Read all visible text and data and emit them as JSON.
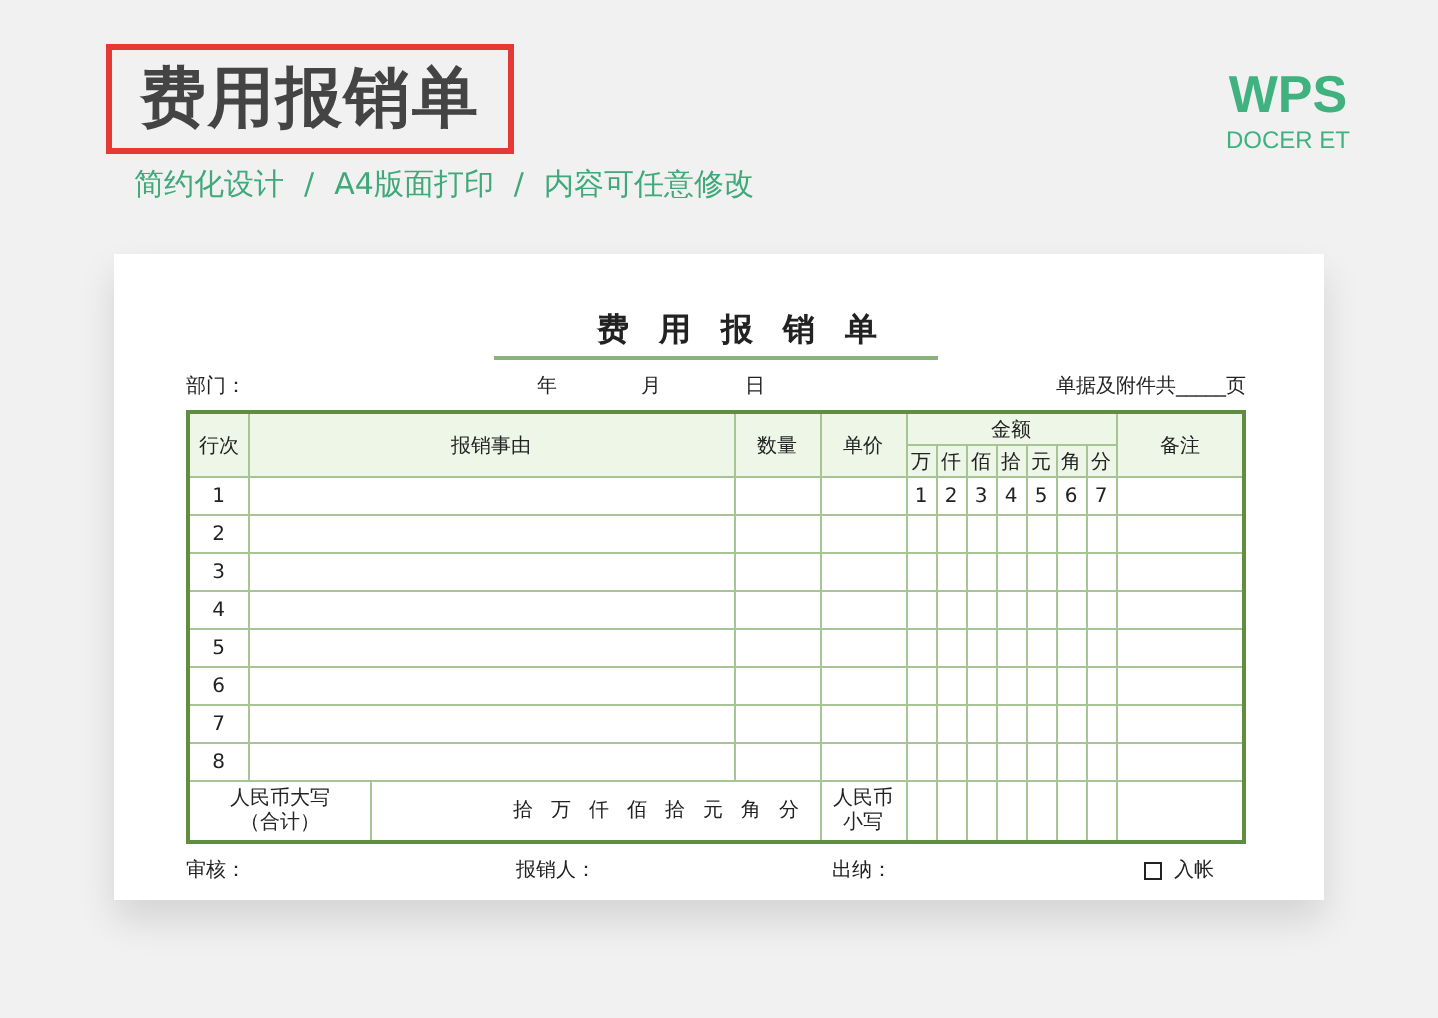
{
  "banner": {
    "title": "费用报销单",
    "highlighted": true,
    "taglines": [
      "简约化设计",
      "A4版面打印",
      "内容可任意修改"
    ],
    "separators": [
      "/",
      "/"
    ]
  },
  "logo": {
    "name": "WPS",
    "subtitle": "DOCER ET"
  },
  "form": {
    "title": "费用报销单",
    "meta": {
      "department": "部门：",
      "date": [
        "年",
        "月",
        "日"
      ],
      "attachments": "单据及附件共_____页"
    },
    "columns": {
      "line": "行次",
      "reason": "报销事由",
      "quantity": "数量",
      "price": "单价",
      "amount": "金额",
      "units": [
        "万",
        "仟",
        "佰",
        "拾",
        "元",
        "角",
        "分"
      ],
      "remark": "备注"
    },
    "rows": [
      {
        "line": "1",
        "digits": [
          "1",
          "2",
          "3",
          "4",
          "5",
          "6",
          "7"
        ]
      },
      {
        "line": "2",
        "digits": []
      },
      {
        "line": "3",
        "digits": []
      },
      {
        "line": "4",
        "digits": []
      },
      {
        "line": "5",
        "digits": []
      },
      {
        "line": "6",
        "digits": []
      },
      {
        "line": "7",
        "digits": []
      },
      {
        "line": "8",
        "digits": []
      }
    ],
    "total": {
      "words_label": [
        "人民币大写",
        "（合计）"
      ],
      "words_units": [
        "拾",
        "万",
        "仟",
        "佰",
        "拾",
        "元",
        "角",
        "分"
      ],
      "figures_label": [
        "人民币",
        "小写"
      ]
    },
    "footer": {
      "reviewer": "审核：",
      "claimant": "报销人：",
      "cashier": "出纳：",
      "posted": {
        "label": "入帐",
        "checked": false
      }
    }
  }
}
